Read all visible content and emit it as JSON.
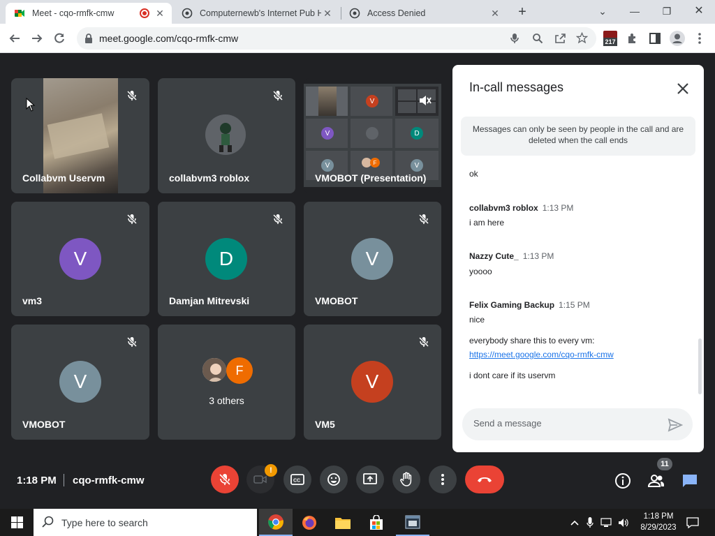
{
  "browser": {
    "tabs": [
      {
        "title": "Meet - cqo-rmfk-cmw",
        "active": true,
        "recording": true
      },
      {
        "title": "Computernewb's Internet Pub H",
        "active": false
      },
      {
        "title": "Access Denied",
        "active": false
      }
    ],
    "url": "meet.google.com/cqo-rmfk-cmw",
    "extension_badge": "217"
  },
  "tiles": [
    {
      "name": "Collabvm Uservm",
      "muted": true
    },
    {
      "name": "collabvm3 roblox",
      "muted": true
    },
    {
      "name": "VMOBOT (Presentation)",
      "muted": true
    },
    {
      "name": "vm3",
      "initial": "V",
      "color": "#7e57c2",
      "muted": true
    },
    {
      "name": "Damjan Mitrevski",
      "initial": "D",
      "color": "#00897b",
      "muted": true
    },
    {
      "name": "VMOBOT",
      "initial": "V",
      "color": "#78909c",
      "muted": true
    },
    {
      "name": "VMOBOT",
      "initial": "V",
      "color": "#78909c",
      "muted": true
    },
    {
      "name": "3 others",
      "initial": "F",
      "color": "#ef6c00"
    },
    {
      "name": "VM5",
      "initial": "V",
      "color": "#c5401f",
      "muted": true
    }
  ],
  "presentation_initials": [
    "V",
    "V",
    "D",
    "V",
    "F",
    "V"
  ],
  "chat": {
    "title": "In-call messages",
    "notice": "Messages can only be seen by people in the call and are deleted when the call ends",
    "messages": [
      {
        "text": "ok"
      },
      {
        "sender": "collabvm3 roblox",
        "time": "1:13 PM",
        "text": "i am here"
      },
      {
        "sender": "Nazzy Cute_",
        "time": "1:13 PM",
        "text": "yoooo"
      },
      {
        "sender": "Felix Gaming Backup",
        "time": "1:15 PM",
        "text": "nice"
      },
      {
        "text": "everybody share this to every vm:"
      },
      {
        "link": "https://meet.google.com/cqo-rmfk-cmw"
      },
      {
        "text": "i dont care if its uservm"
      }
    ],
    "input_placeholder": "Send a message"
  },
  "bottom_bar": {
    "time": "1:18 PM",
    "meeting_code": "cqo-rmfk-cmw",
    "participants_count": "11",
    "camera_alert": "!"
  },
  "taskbar": {
    "search_placeholder": "Type here to search",
    "time": "1:18 PM",
    "date": "8/29/2023"
  },
  "colors": {
    "meet_bg": "#202124",
    "tile_bg": "#3c4043",
    "hangup": "#ea4335",
    "accent": "#1a73e8"
  }
}
